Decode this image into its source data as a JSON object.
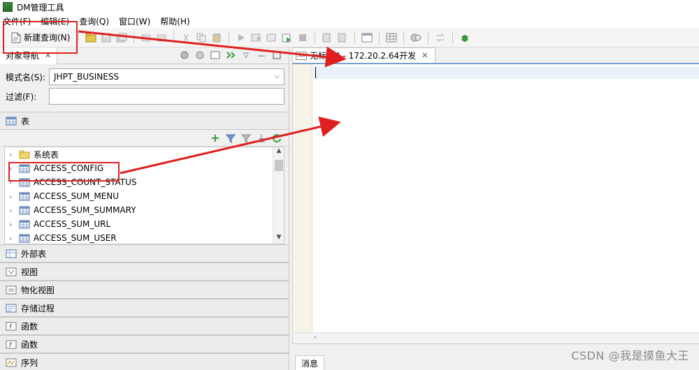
{
  "window": {
    "title": "DM管理工具"
  },
  "menu": [
    "文件(F)",
    "编辑(E)",
    "查询(Q)",
    "窗口(W)",
    "帮助(H)"
  ],
  "toolbar": {
    "new_query_label": "新建查询(N)"
  },
  "navigator": {
    "tab_label": "对象导航",
    "schema_label": "模式名(S):",
    "schema_value": "JHPT_BUSINESS",
    "filter_label": "过滤(F):",
    "filter_value": "",
    "tables_section": "表",
    "tree_items": [
      "系统表",
      "ACCESS_CONFIG",
      "ACCESS_COUNT_STATUS",
      "ACCESS_SUM_MENU",
      "ACCESS_SUM_SUMMARY",
      "ACCESS_SUM_URL",
      "ACCESS_SUM_USER"
    ],
    "sections": [
      "外部表",
      "视图",
      "物化视图",
      "存储过程",
      "函数",
      "函数",
      "序列"
    ]
  },
  "editor": {
    "tab_label": "无标题4 - 172.20.2.64开发",
    "sql_badge": "SQL"
  },
  "bottom": {
    "messages_tab": "消息"
  },
  "watermark": "CSDN @我是摸鱼大王",
  "colors": {
    "highlight": "#e02020",
    "editor_tab_accent": "#7aa0d0"
  }
}
